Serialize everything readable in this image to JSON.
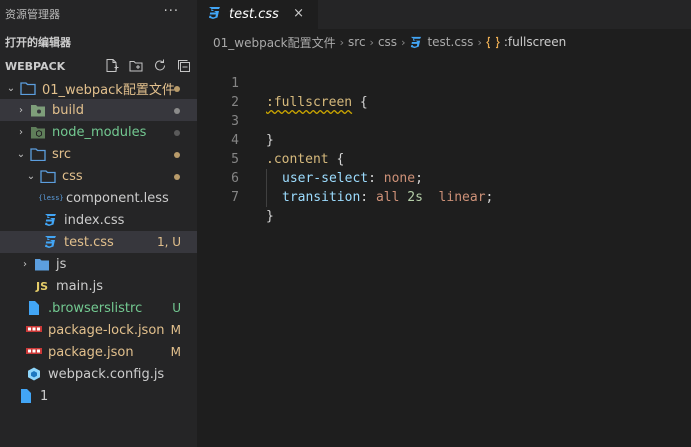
{
  "sidebar": {
    "title": "资源管理器",
    "more_icon": "ellipsis-icon",
    "open_editors": "打开的编辑器",
    "project": "WEBPACK",
    "actions": [
      "new-file-icon",
      "new-folder-icon",
      "refresh-icon",
      "collapse-all-icon"
    ],
    "tree": [
      {
        "label": "01_webpack配置文件",
        "kind": "folder-open",
        "status": "dot",
        "status_color": "yellow"
      },
      {
        "label": "build",
        "kind": "folder",
        "status": "dot",
        "status_color": "gray"
      },
      {
        "label": "node_modules",
        "kind": "folder",
        "status": "dot",
        "status_color": "gray"
      },
      {
        "label": "src",
        "kind": "folder-open",
        "status": "dot",
        "status_color": "yellow"
      },
      {
        "label": "css",
        "kind": "folder-open",
        "status": "dot",
        "status_color": "yellow"
      },
      {
        "label": "component.less",
        "kind": "less"
      },
      {
        "label": "index.css",
        "kind": "css"
      },
      {
        "label": "test.css",
        "kind": "css",
        "badge": "1, U"
      },
      {
        "label": "js",
        "kind": "folder"
      },
      {
        "label": "main.js",
        "kind": "js"
      },
      {
        "label": ".browserslistrc",
        "kind": "file",
        "badge": "U"
      },
      {
        "label": "package-lock.json",
        "kind": "npm",
        "badge": "M"
      },
      {
        "label": "package.json",
        "kind": "npm",
        "badge": "M"
      },
      {
        "label": "webpack.config.js",
        "kind": "webpack"
      },
      {
        "label": "1",
        "kind": "file"
      }
    ]
  },
  "tab": {
    "label": "test.css",
    "close": "×"
  },
  "breadcrumb": {
    "items": [
      "01_webpack配置文件",
      "src",
      "css",
      "test.css",
      ":fullscreen"
    ],
    "separator": "›"
  },
  "editor": {
    "line_numbers": [
      "1",
      "2",
      "3",
      "4",
      "5",
      "6",
      "7"
    ],
    "line1_selector": ":fullscreen",
    "line1_brace": " {",
    "line3": "}",
    "line4_selector": ".content",
    "line4_brace": " {",
    "line5_prop": "user-select",
    "line5_colon": ": ",
    "line5_value": "none",
    "line5_semi": ";",
    "line6_prop": "transition",
    "line6_colon": ": ",
    "line6_value1": "all ",
    "line6_num": "2s",
    "line6_value2": "  linear",
    "line6_semi": ";",
    "line7": "}"
  },
  "colors": {
    "accent_css": "#42a5f5",
    "folder": "#5c9ede",
    "modified": "#e2c08d",
    "untracked": "#73c991",
    "selector": "#d7ba7d",
    "property": "#9cdcfe",
    "value": "#ce9178",
    "number": "#b5cea8"
  }
}
